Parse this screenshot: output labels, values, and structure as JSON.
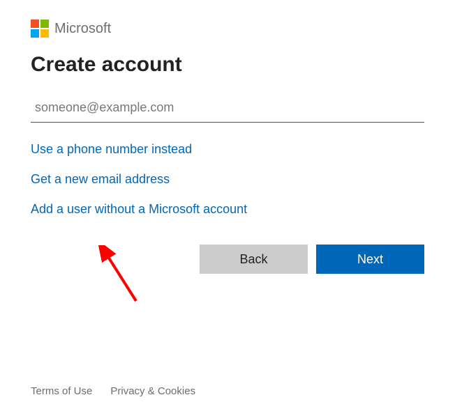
{
  "brand": {
    "name": "Microsoft"
  },
  "heading": "Create account",
  "email": {
    "placeholder": "someone@example.com"
  },
  "links": {
    "phone": "Use a phone number instead",
    "newEmail": "Get a new email address",
    "noAccount": "Add a user without a Microsoft account"
  },
  "buttons": {
    "back": "Back",
    "next": "Next"
  },
  "footer": {
    "terms": "Terms of Use",
    "privacy": "Privacy & Cookies"
  }
}
